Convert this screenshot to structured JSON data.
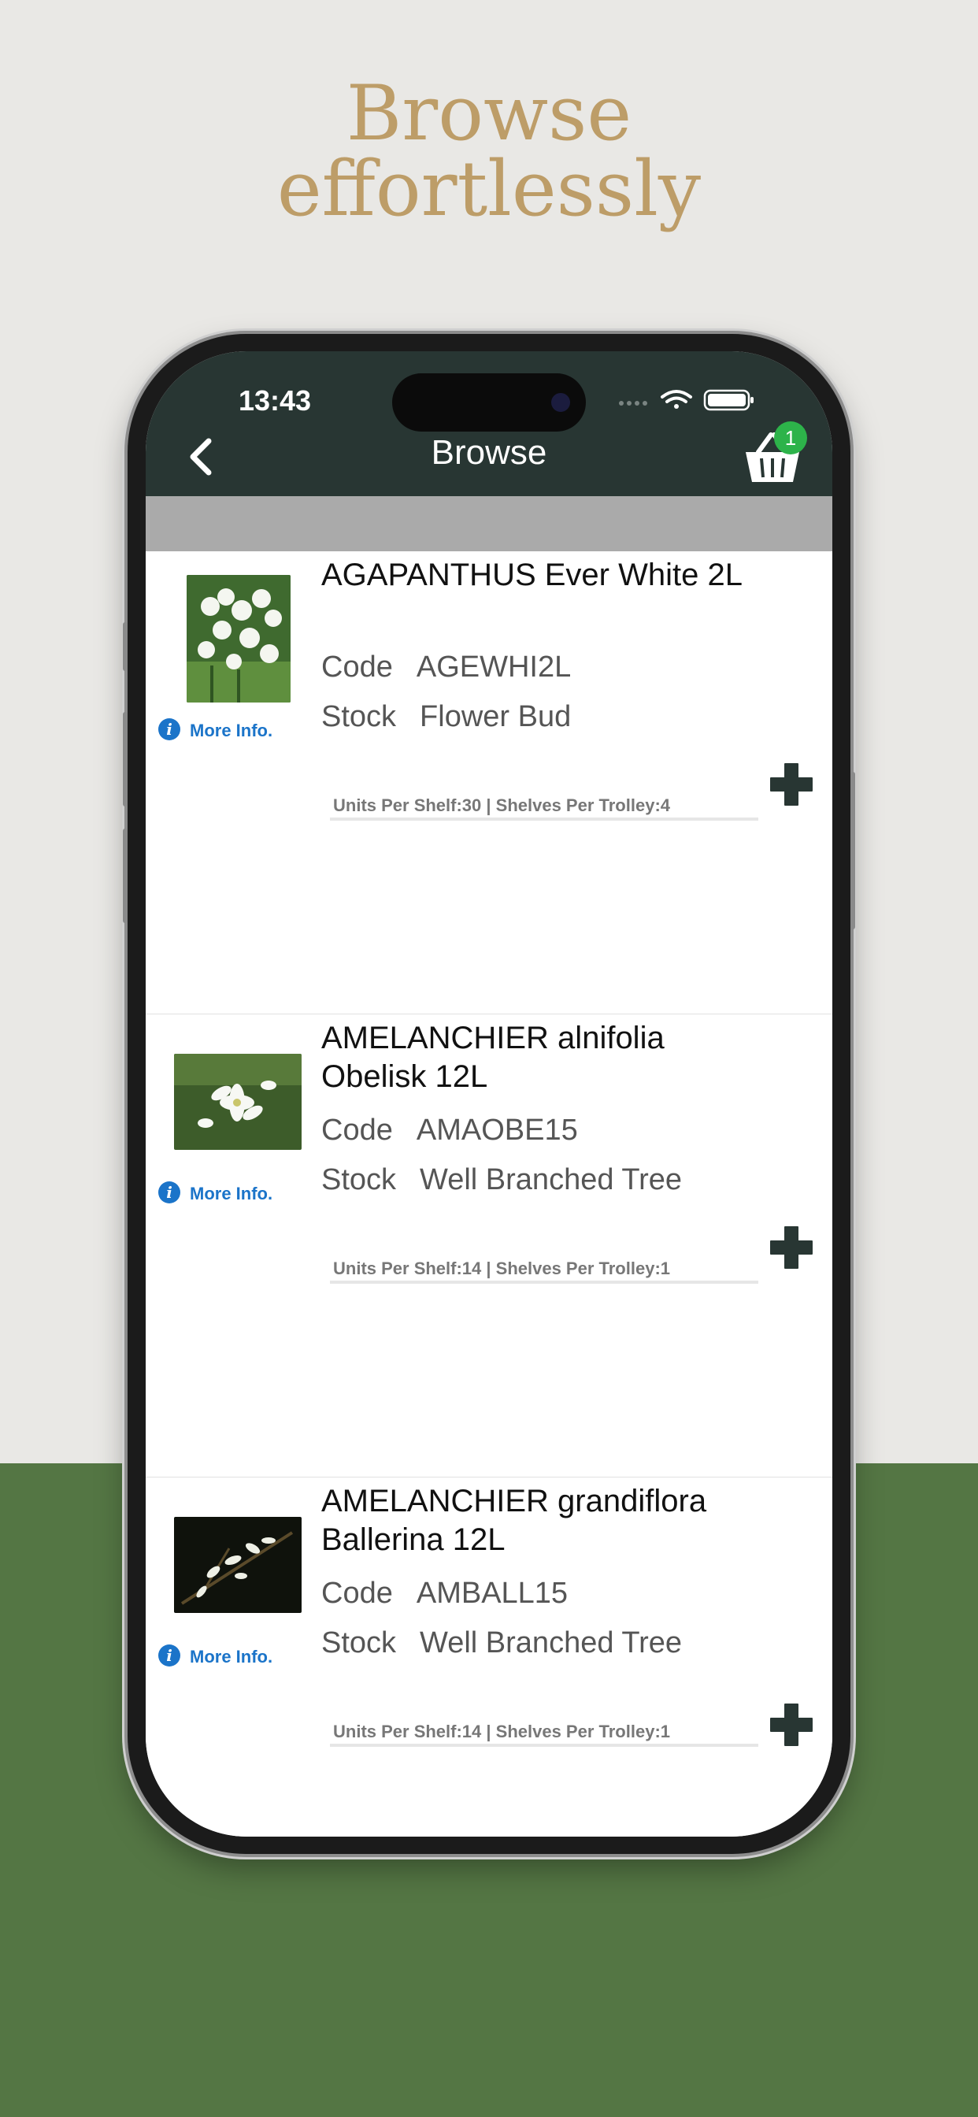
{
  "headline": {
    "line1": "Browse",
    "line2": "effortlessly"
  },
  "status_bar": {
    "time": "13:43"
  },
  "nav": {
    "title": "Browse",
    "cart_count": "1"
  },
  "colors": {
    "nav_bg": "#283633",
    "headline_gold": "#BD9D68",
    "bottom_green": "#547644",
    "badge_green": "#2DB34A",
    "link_blue": "#1B74C9"
  },
  "products": [
    {
      "name": "AGAPANTHUS Ever White 2L",
      "code_label": "Code",
      "code": "AGEWHI2L",
      "stock_label": "Stock",
      "stock": "Flower Bud",
      "units": "Units Per Shelf:30 | Shelves Per Trolley:4",
      "more_info": "More Info.",
      "image_icon": "white-agapanthus-photo"
    },
    {
      "name": "AMELANCHIER alnifolia Obelisk 12L",
      "code_label": "Code",
      "code": "AMAOBE15",
      "stock_label": "Stock",
      "stock": "Well Branched Tree",
      "units": "Units Per Shelf:14 | Shelves Per Trolley:1",
      "more_info": "More Info.",
      "image_icon": "white-blossom-photo"
    },
    {
      "name": "AMELANCHIER grandiflora Ballerina 12L",
      "code_label": "Code",
      "code": "AMBALL15",
      "stock_label": "Stock",
      "stock": "Well Branched Tree",
      "units": "Units Per Shelf:14 | Shelves Per Trolley:1",
      "more_info": "More Info.",
      "image_icon": "white-blossom-dark-photo"
    }
  ]
}
